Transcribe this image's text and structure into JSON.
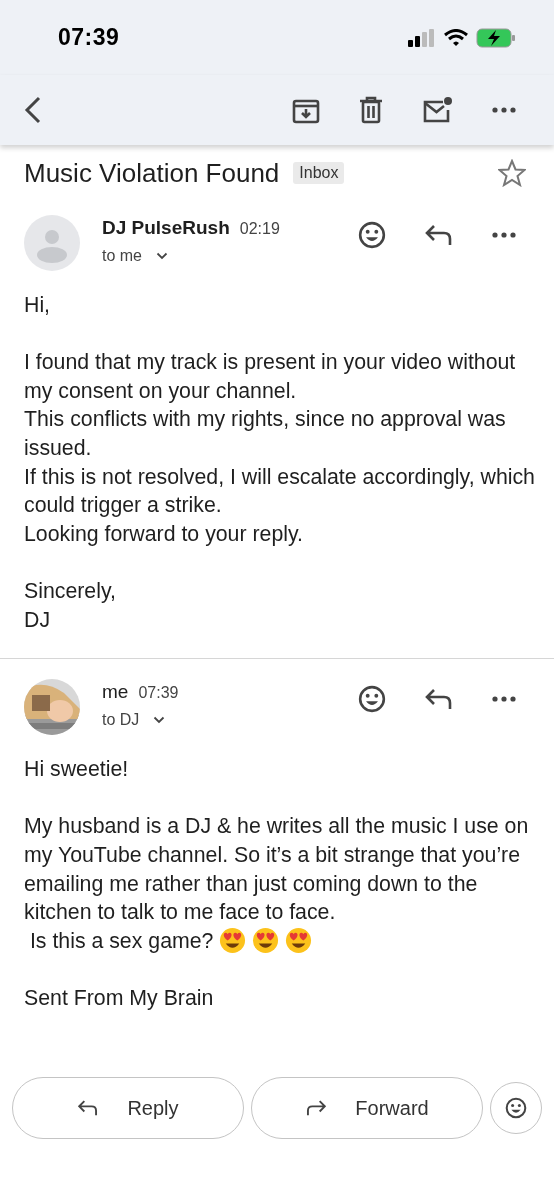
{
  "status_bar": {
    "time": "07:39"
  },
  "subject": {
    "title": "Music Violation Found",
    "label": "Inbox",
    "starred": false
  },
  "messages": [
    {
      "sender": "DJ PulseRush",
      "emphasized": true,
      "avatar": {
        "kind": "placeholder"
      },
      "time": "02:19",
      "recipients": "to me",
      "paragraphs": [
        [
          {
            "text": "Hi,"
          }
        ],
        [
          {
            "text": "I found that my track is present in your video without my consent on your channel."
          },
          {
            "text": "This conflicts with my rights, since no approval was issued."
          },
          {
            "text": "If this is not resolved, I will escalate accordingly, which could trigger a strike."
          },
          {
            "text": "Looking forward to your reply."
          }
        ],
        [
          {
            "text": "Sincerely,"
          },
          {
            "text": "DJ"
          }
        ]
      ]
    },
    {
      "sender": "me",
      "emphasized": false,
      "avatar": {
        "kind": "picture"
      },
      "time": "07:39",
      "recipients": "to DJ",
      "paragraphs": [
        [
          {
            "text": "Hi sweetie!"
          }
        ],
        [
          {
            "text": "My husband is a DJ & he writes all the music I use on my YouTube channel. So it’s a bit strange that you’re emailing me rather than just coming down to the kitchen to talk to me face to face."
          },
          {
            "text": " Is this a sex game?",
            "emoji": [
              {
                "kind": "heart-eyes"
              },
              {
                "kind": "heart-eyes"
              },
              {
                "kind": "heart-eyes"
              }
            ]
          }
        ],
        [
          {
            "text": "Sent From My Brain"
          }
        ]
      ]
    }
  ],
  "actions": [
    {
      "label": "Reply",
      "kind": "reply"
    },
    {
      "label": "Forward",
      "kind": "forward"
    }
  ]
}
